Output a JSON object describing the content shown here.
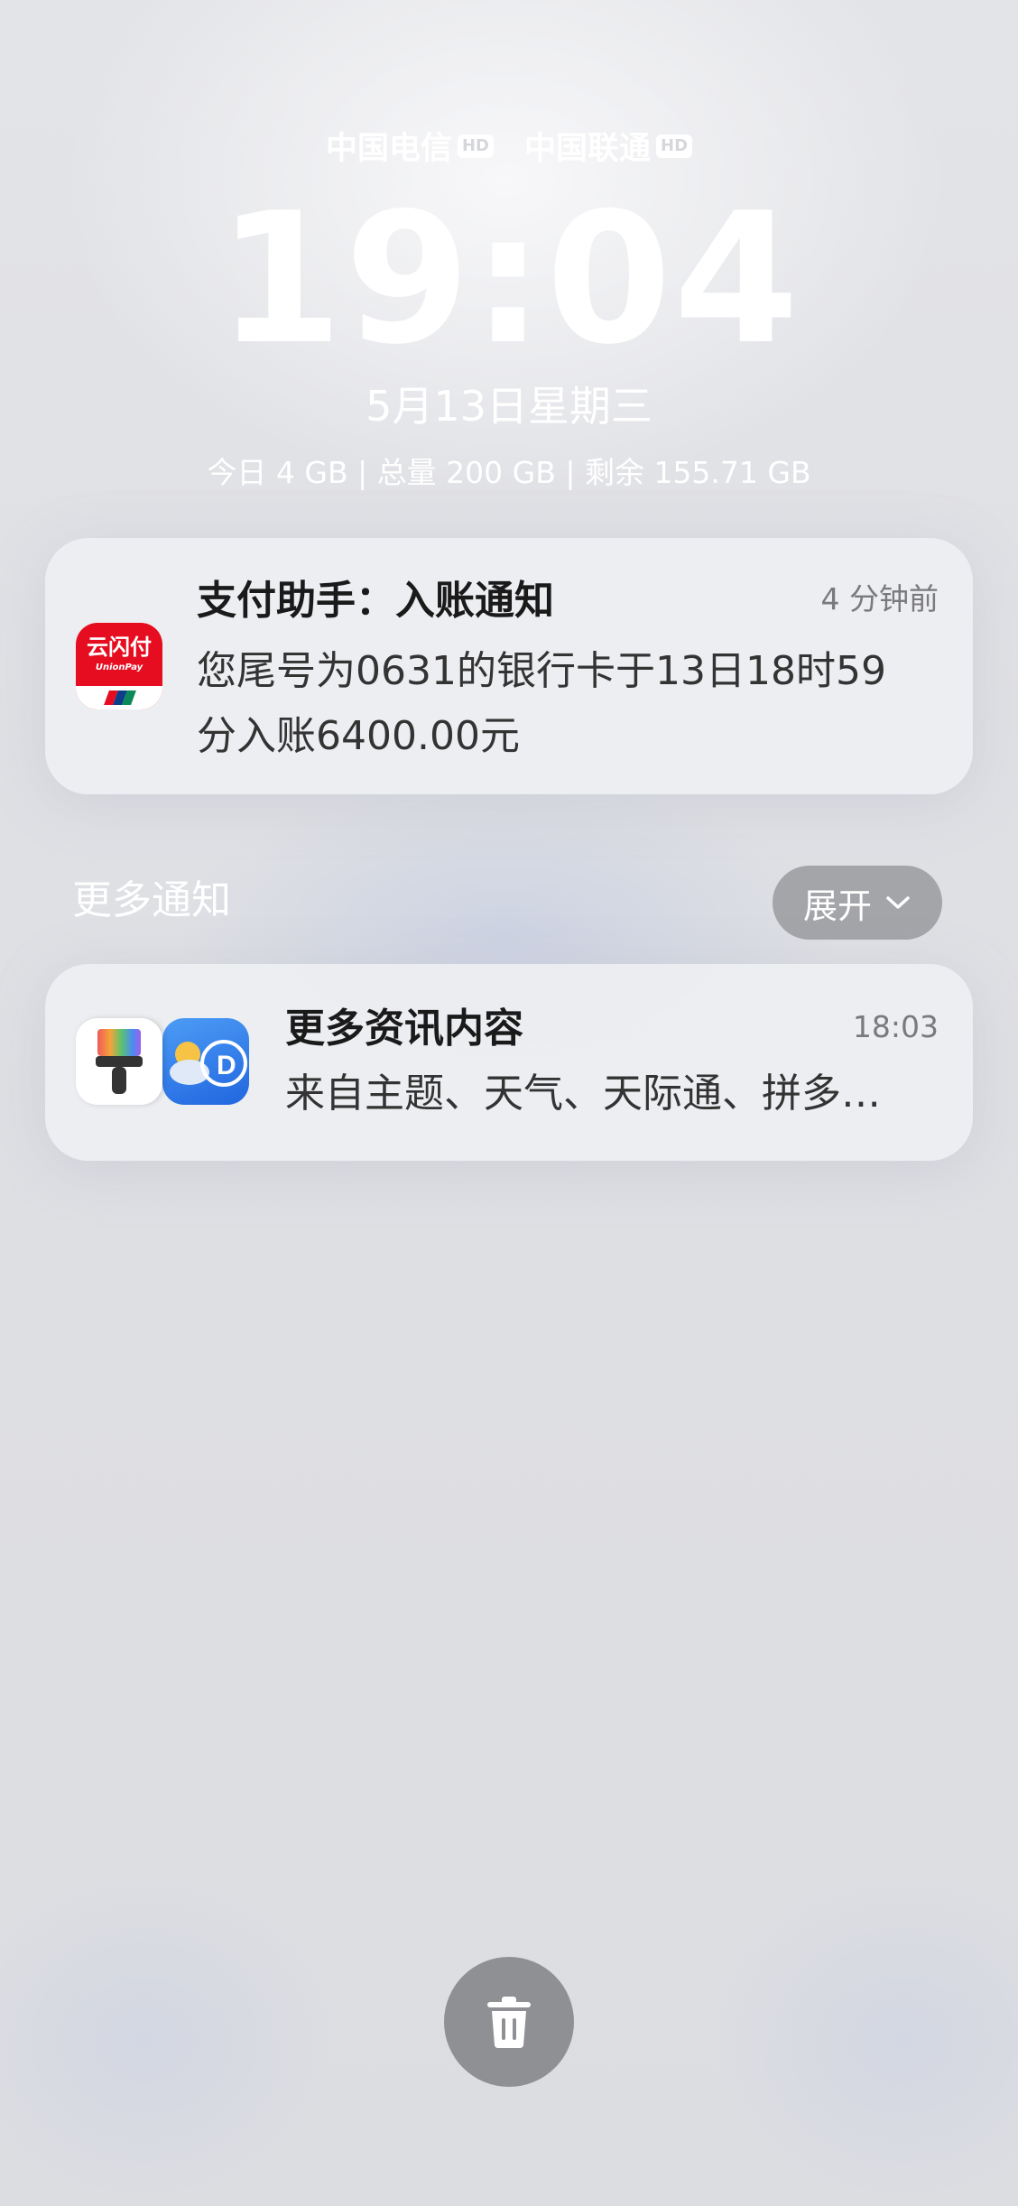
{
  "status": {
    "carriers": [
      {
        "name": "中国电信",
        "badge": "HD"
      },
      {
        "name": "中国联通",
        "badge": "HD"
      }
    ]
  },
  "lockscreen": {
    "time": "19:04",
    "date": "5月13日星期三",
    "data_usage": "今日 4 GB | 总量 200 GB | 剩余 155.71 GB"
  },
  "notifications": {
    "payment": {
      "app_icon": "unionpay-icon",
      "icon_text": "云闪付",
      "icon_subtext": "UnionPay",
      "title": "支付助手：入账通知",
      "time": "4 分钟前",
      "body_line1": "您尾号为0631的银行卡于13日18时59",
      "body_line2": "分入账6400.00元"
    },
    "more_section": {
      "header": "更多通知",
      "expand_label": "展开"
    },
    "more": {
      "app_icons": [
        "themes-icon",
        "weather-icon",
        "tianjitong-icon"
      ],
      "title": "更多资讯内容",
      "time": "18:03",
      "body": "来自主题、天气、天际通、拼多…"
    }
  },
  "actions": {
    "clear_icon": "trash-icon"
  },
  "colors": {
    "unionpay_red": "#e60d21",
    "card_bg": "#eeeff2",
    "expand_button_bg": "#a4a5a9",
    "trash_button_bg": "#8f9093"
  }
}
